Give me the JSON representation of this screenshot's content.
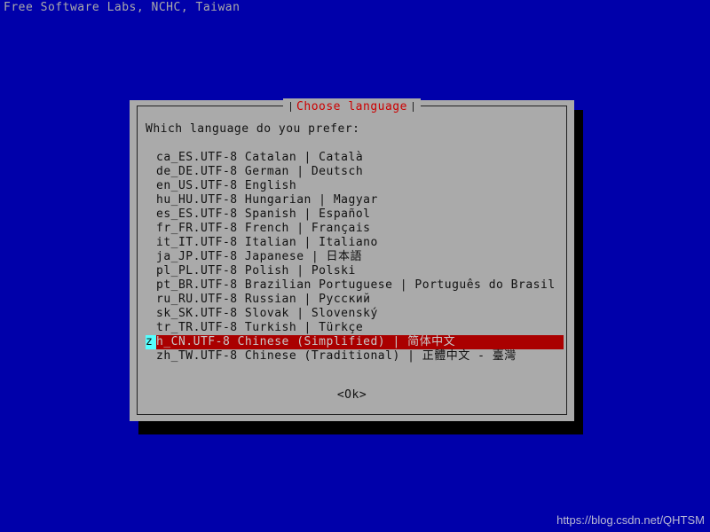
{
  "screen": {
    "background_color": "#0000aa",
    "banner_text": "Free Software Labs, NCHC, Taiwan",
    "banner_color": "#aaaaaa"
  },
  "dialog": {
    "title": "Choose language",
    "title_color": "#cc0000",
    "background_color": "#aaaaaa",
    "border_color": "#222222",
    "prompt": "Which language do you prefer:",
    "highlight_color": "#aa0000",
    "cursor_color": "#55ffff",
    "ok_label": "<Ok>",
    "items": [
      {
        "label": "ca_ES.UTF-8 Catalan | Català",
        "selected": false
      },
      {
        "label": "de_DE.UTF-8 German | Deutsch",
        "selected": false
      },
      {
        "label": "en_US.UTF-8 English",
        "selected": false
      },
      {
        "label": "hu_HU.UTF-8 Hungarian | Magyar",
        "selected": false
      },
      {
        "label": "es_ES.UTF-8 Spanish | Español",
        "selected": false
      },
      {
        "label": "fr_FR.UTF-8 French | Français",
        "selected": false
      },
      {
        "label": "it_IT.UTF-8 Italian | Italiano",
        "selected": false
      },
      {
        "label": "ja_JP.UTF-8 Japanese | 日本語",
        "selected": false
      },
      {
        "label": "pl_PL.UTF-8 Polish | Polski",
        "selected": false
      },
      {
        "label": "pt_BR.UTF-8 Brazilian Portuguese | Português do Brasil",
        "selected": false
      },
      {
        "label": "ru_RU.UTF-8 Russian | Русский",
        "selected": false
      },
      {
        "label": "sk_SK.UTF-8 Slovak | Slovenský",
        "selected": false
      },
      {
        "label": "tr_TR.UTF-8 Turkish | Türkçe",
        "selected": false
      },
      {
        "label": "zh_CN.UTF-8 Chinese (Simplified) | 简体中文",
        "selected": true,
        "cursor_char": "z",
        "rest": "h_CN.UTF-8 Chinese (Simplified) | 简体中文"
      },
      {
        "label": "zh_TW.UTF-8 Chinese (Traditional) | 正體中文 - 臺灣",
        "selected": false
      }
    ]
  },
  "watermark": {
    "text": "https://blog.csdn.net/QHTSM"
  }
}
